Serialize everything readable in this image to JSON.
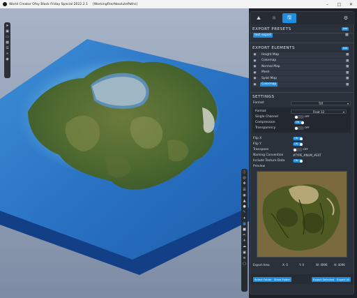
{
  "window": {
    "title": "World Creator Ofxy Black Friday Special 2022.2.1",
    "path": "[WorkingFile/AbsolutePaths]",
    "min_icon": "minimize-icon",
    "max_icon": "maximize-icon",
    "close_icon": "close-icon"
  },
  "left_toolbar": {
    "icons": [
      "cursor-icon",
      "folder-icon",
      "file-icon",
      "save-icon",
      "layers-icon",
      "link-icon",
      "camera-icon"
    ]
  },
  "right_toolbar": {
    "icons": [
      "info-icon",
      "globe-icon",
      "move-icon",
      "layers-icon",
      "palette-icon",
      "terrain-icon",
      "drop-icon",
      "brush-icon",
      "wand-icon",
      "grid-icon",
      "paint-icon",
      "brush-alt-icon",
      "sun-icon",
      "cloud-icon",
      "image-icon",
      "stack-icon",
      "box-icon"
    ]
  },
  "tabs": {
    "items": [
      {
        "name": "tab-scene",
        "icon": "landscape-icon"
      },
      {
        "name": "tab-lighting",
        "icon": "sun-icon"
      },
      {
        "name": "tab-export",
        "icon": "save-icon",
        "active": true
      }
    ],
    "gear_icon": "gear-icon"
  },
  "export_presets": {
    "title": "EXPORT PRESETS",
    "add_label": "Add",
    "preset_label": "test export"
  },
  "export_elements": {
    "title": "EXPORT ELEMENTS",
    "add_label": "Add",
    "items": [
      {
        "label": "Height Map",
        "selected": false
      },
      {
        "label": "Colormap",
        "selected": false
      },
      {
        "label": "Normal Map",
        "selected": false
      },
      {
        "label": "Mesh",
        "selected": false
      },
      {
        "label": "Splat Map",
        "selected": false
      },
      {
        "label": "Colormap",
        "selected": true
      }
    ]
  },
  "settings": {
    "title": "SETTINGS",
    "format_label": "Format",
    "format_value": "Tiff",
    "sub_format_label": "Format",
    "sub_format_value": "Float 32",
    "single_channel_label": "Single Channel",
    "single_channel_value": "OFF",
    "compression_label": "Compression",
    "compression_value": "ON",
    "transparency_label": "Transparency",
    "transparency_value": "OFF",
    "flip_x_label": "Flip X",
    "flip_x_value": "ON",
    "flip_y_label": "Flip Y",
    "flip_y_value": "ON",
    "transpose_label": "Transpose",
    "transpose_value": "OFF",
    "naming_label": "Naming Convention",
    "naming_value": "#TYPE_#NUM_#EXT",
    "include_label": "Include Texture Data",
    "include_value": "ON",
    "preview_label": "Preview"
  },
  "export_area": {
    "label": "Export Area",
    "x": "X: 0",
    "y": "Y: 0",
    "w": "W: 4096",
    "h": "H: 4096"
  },
  "buttons": {
    "select_folder": "Select Folder",
    "show_folder": "Show Folder",
    "export_selected": "Export Selected",
    "export_all": "Export All"
  }
}
